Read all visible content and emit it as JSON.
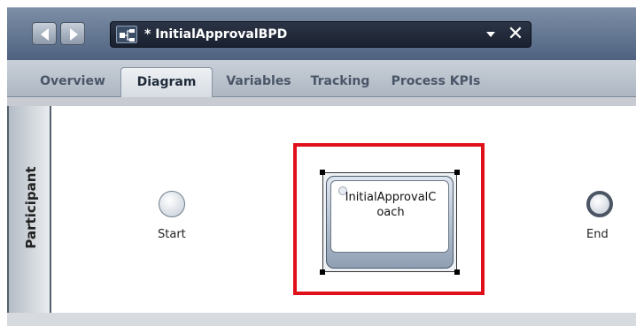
{
  "window": {
    "nav_back_icon": "arrow-left-icon",
    "nav_forward_icon": "arrow-right-icon",
    "document_icon": "process-diagram-icon",
    "document_title": "* InitialApprovalBPD",
    "dropdown_icon": "chevron-down-icon",
    "close_icon": "close-icon",
    "close_glyph": "✕"
  },
  "tabs": [
    {
      "label": "Overview",
      "active": false
    },
    {
      "label": "Diagram",
      "active": true
    },
    {
      "label": "Variables",
      "active": false
    },
    {
      "label": "Tracking",
      "active": false
    },
    {
      "label": "Process KPIs",
      "active": false
    }
  ],
  "diagram": {
    "lane_label": "Participant",
    "start_event": {
      "label": "Start"
    },
    "task": {
      "label": "InitialApprovalCoach",
      "label_lines": [
        "InitialApprovalC",
        "oach"
      ],
      "selected": true
    },
    "end_event": {
      "label": "End"
    },
    "highlight_color": "#e0101a"
  }
}
